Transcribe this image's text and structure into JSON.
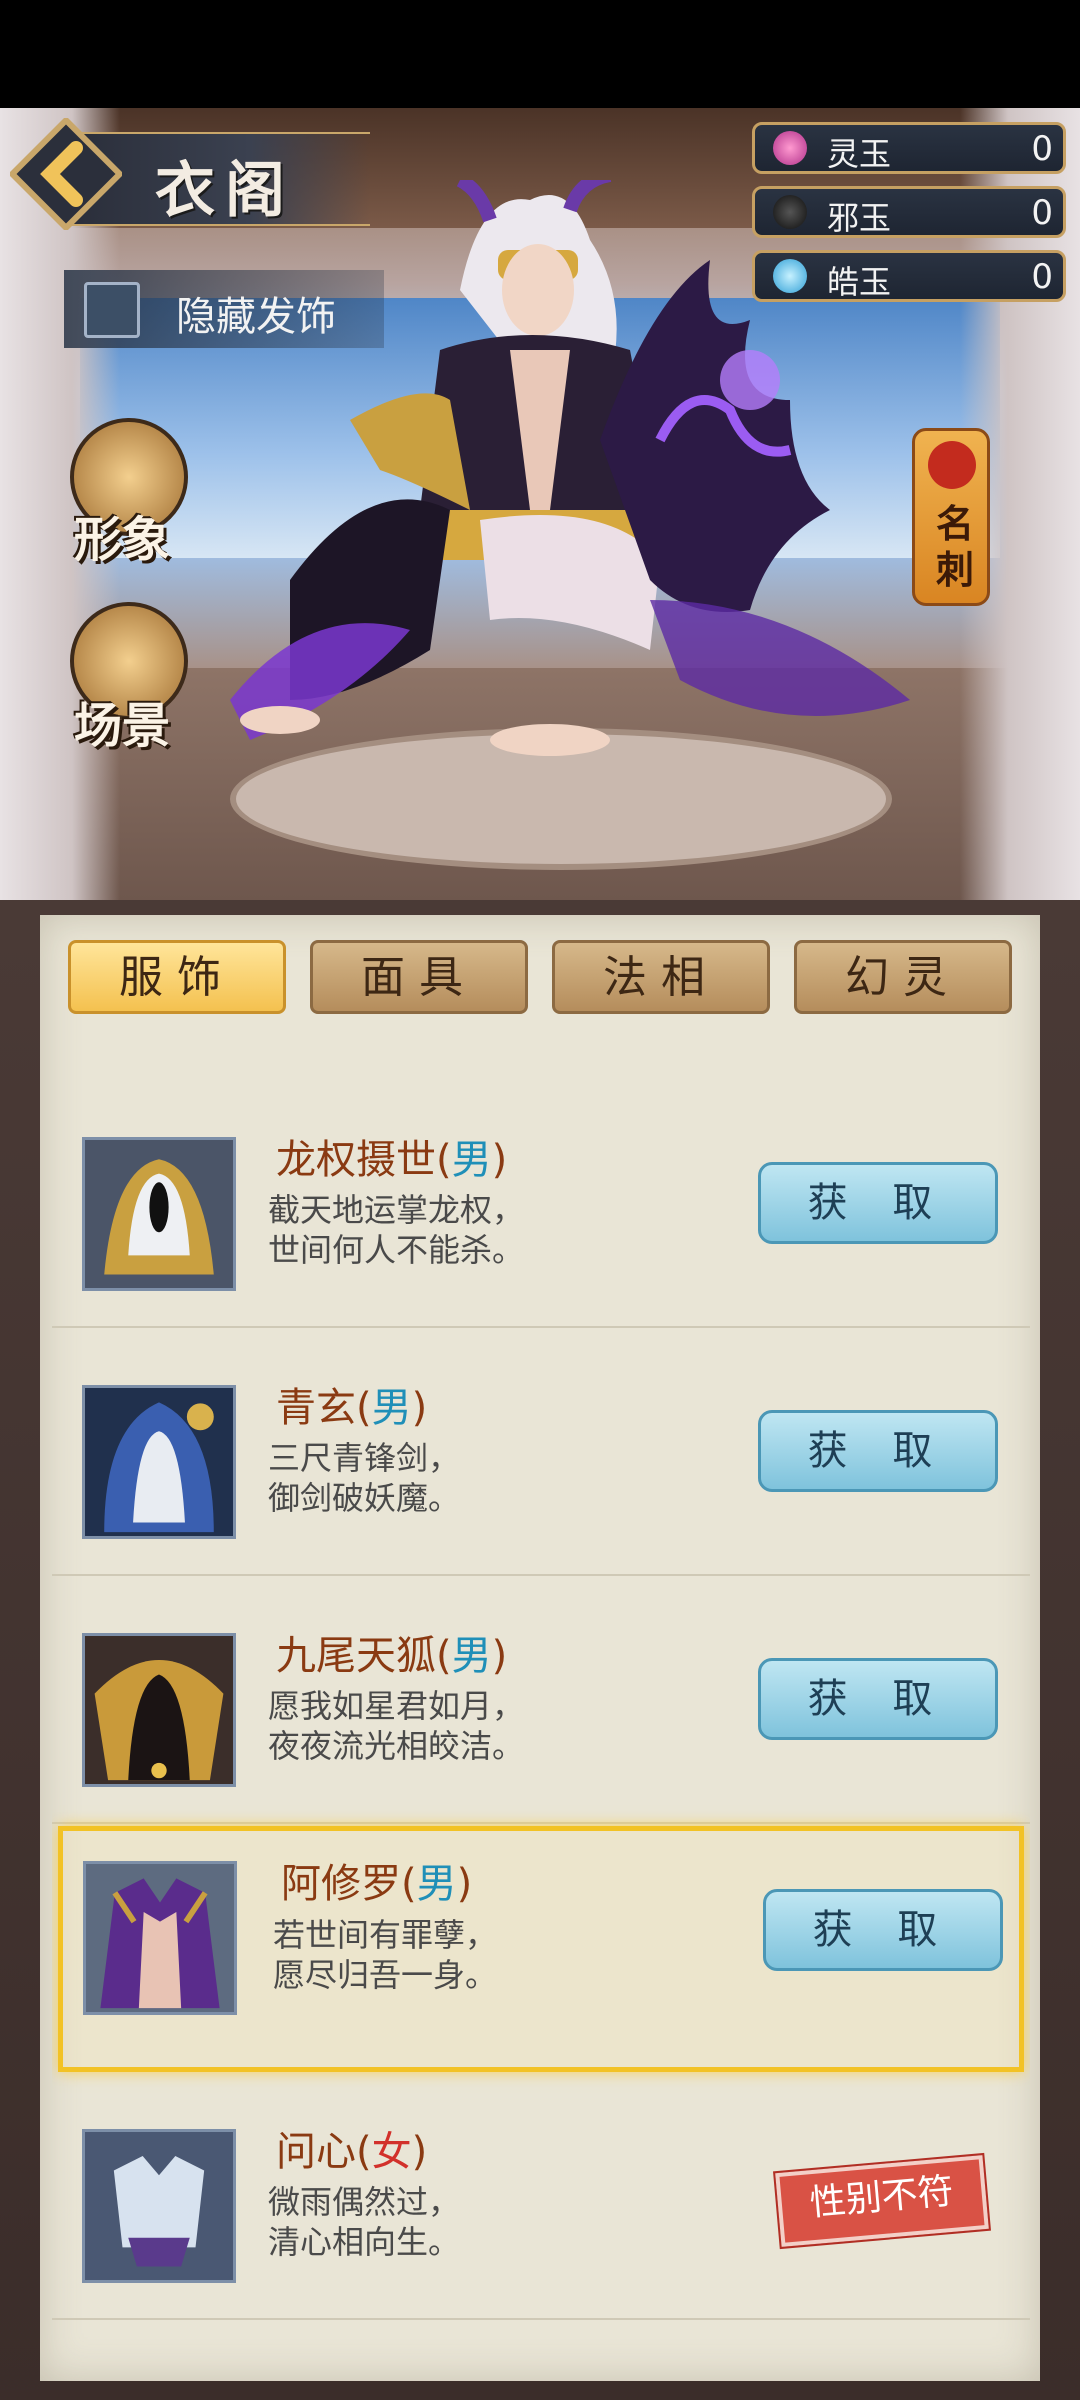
{
  "header": {
    "title": "衣阁",
    "hide_accessory_label": "隐藏发饰"
  },
  "currencies": [
    {
      "name": "灵玉",
      "value": "0",
      "icon": "pink-jade-icon"
    },
    {
      "name": "邪玉",
      "value": "0",
      "icon": "dark-jade-icon"
    },
    {
      "name": "皓玉",
      "value": "0",
      "icon": "blue-jade-icon"
    }
  ],
  "side_buttons": {
    "appearance": "形象",
    "scene": "场景",
    "name_card": "名刺"
  },
  "tabs": [
    {
      "label": "服饰",
      "active": true
    },
    {
      "label": "面具",
      "active": false
    },
    {
      "label": "法相",
      "active": false
    },
    {
      "label": "幻灵",
      "active": false
    }
  ],
  "items": [
    {
      "name": "龙权摄世",
      "gender": "男",
      "line1": "截天地运掌龙权，",
      "line2": "世间何人不能杀。",
      "action": "获 取"
    },
    {
      "name": "青玄",
      "gender": "男",
      "line1": "三尺青锋剑，",
      "line2": "御剑破妖魔。",
      "action": "获 取"
    },
    {
      "name": "九尾天狐",
      "gender": "男",
      "line1": "愿我如星君如月，",
      "line2": "夜夜流光相皎洁。",
      "action": "获 取"
    },
    {
      "name": "阿修罗",
      "gender": "男",
      "line1": "若世间有罪孽，",
      "line2": "愿尽归吾一身。",
      "action": "获 取"
    },
    {
      "name": "问心",
      "gender": "女",
      "line1": "微雨偶然过，",
      "line2": "清心相向生。",
      "action": "性别不符"
    }
  ],
  "paren_open": "(",
  "paren_close": ")"
}
